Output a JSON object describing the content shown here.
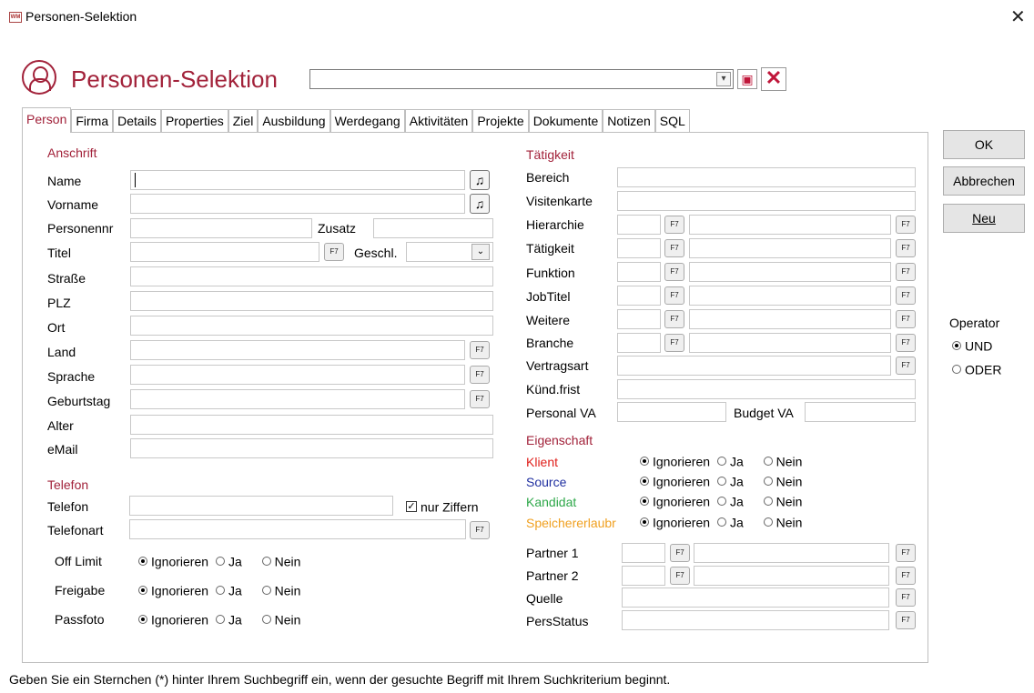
{
  "window": {
    "title": "Personen-Selektion",
    "close": "✕"
  },
  "header": {
    "title": "Personen-Selektion",
    "combo_value": "",
    "combo_arrow": "▾",
    "save_icon": "floppy-icon",
    "delete_icon": "✕"
  },
  "tabs": [
    "Person",
    "Firma",
    "Details",
    "Properties",
    "Ziel",
    "Ausbildung",
    "Werdegang",
    "Aktivitäten",
    "Projekte",
    "Dokumente",
    "Notizen",
    "SQL"
  ],
  "buttons": {
    "ok": "OK",
    "cancel": "Abbrechen",
    "new": "Neu"
  },
  "operator": {
    "label": "Operator",
    "und": "UND",
    "oder": "ODER",
    "selected": "UND"
  },
  "anschrift": {
    "title": "Anschrift",
    "name": "Name",
    "vorname": "Vorname",
    "personennr": "Personennr",
    "zusatz": "Zusatz",
    "titel": "Titel",
    "geschl": "Geschl.",
    "strasse": "Straße",
    "plz": "PLZ",
    "ort": "Ort",
    "land": "Land",
    "sprache": "Sprache",
    "geburtstag": "Geburtstag",
    "alter": "Alter",
    "email": "eMail"
  },
  "telefon": {
    "title": "Telefon",
    "telefon": "Telefon",
    "telefonart": "Telefonart",
    "nur_ziffern": "nur Ziffern",
    "nur_ziffern_checked": true
  },
  "flags": [
    {
      "label": "Off Limit",
      "selected": "Ignorieren"
    },
    {
      "label": "Freigabe",
      "selected": "Ignorieren"
    },
    {
      "label": "Passfoto",
      "selected": "Ignorieren"
    }
  ],
  "radio_opts": {
    "ignore": "Ignorieren",
    "ja": "Ja",
    "nein": "Nein"
  },
  "taetigkeit": {
    "title": "Tätigkeit",
    "bereich": "Bereich",
    "visitenkarte": "Visitenkarte",
    "hierarchie": "Hierarchie",
    "taetigkeit": "Tätigkeit",
    "funktion": "Funktion",
    "jobtitel": "JobTitel",
    "weitere": "Weitere",
    "branche": "Branche",
    "vertragsart": "Vertragsart",
    "kuendfrist": "Künd.frist",
    "personal_va": "Personal VA",
    "budget_va": "Budget VA"
  },
  "eigenschaft": {
    "title": "Eigenschaft",
    "items": [
      {
        "label": "Klient",
        "color": "#e0201c"
      },
      {
        "label": "Source",
        "color": "#1f2fa0"
      },
      {
        "label": "Kandidat",
        "color": "#2ea84a"
      },
      {
        "label": "Speichererlaubr",
        "color": "#f0a020"
      }
    ]
  },
  "partner": {
    "p1": "Partner 1",
    "p2": "Partner 2",
    "quelle": "Quelle",
    "persstatus": "PersStatus"
  },
  "f7": "F7",
  "note_icon": "♫",
  "footer": "Geben Sie ein Sternchen (*) hinter Ihrem Suchbegriff ein, wenn der gesuchte Begriff mit Ihrem Suchkriterium beginnt."
}
